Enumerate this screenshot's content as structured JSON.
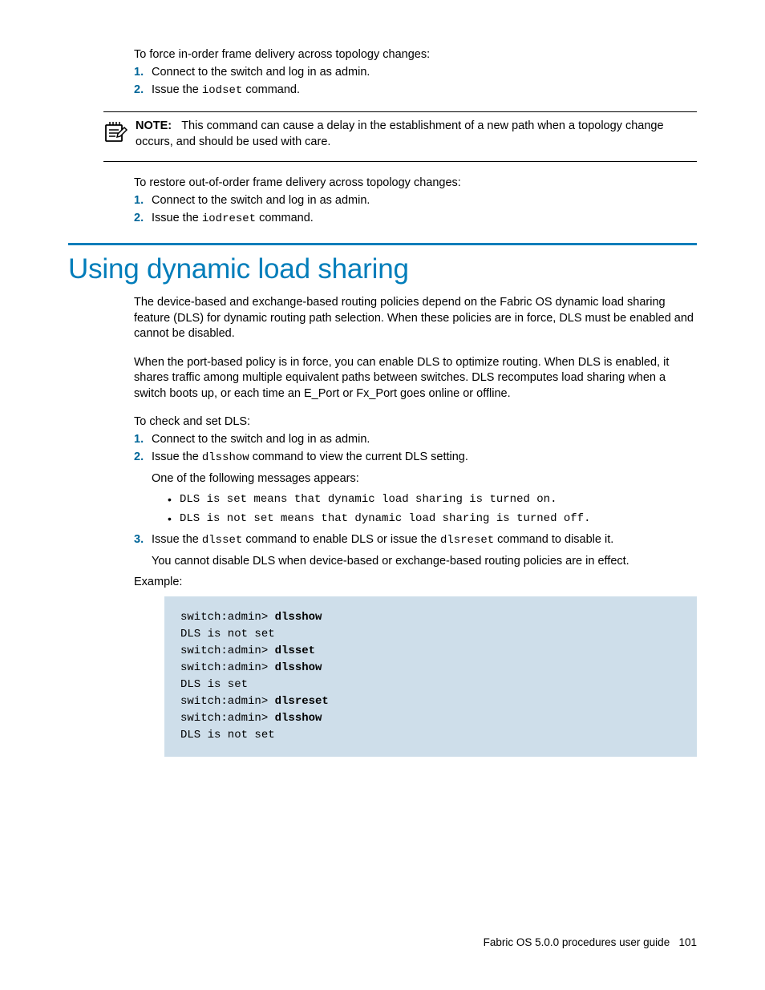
{
  "section1": {
    "intro": "To force in-order frame delivery across topology changes:",
    "item1_num": "1.",
    "item1_text": "Connect to the switch and log in as admin.",
    "item2_num": "2.",
    "item2_prefix": "Issue the ",
    "item2_cmd": "iodset",
    "item2_suffix": " command."
  },
  "note": {
    "label": "NOTE:",
    "text": "This command can cause a delay in the establishment of a new path when a topology change occurs, and should be used with care."
  },
  "section2": {
    "intro": "To restore out-of-order frame delivery across topology changes:",
    "item1_num": "1.",
    "item1_text": "Connect to the switch and log in as admin.",
    "item2_num": "2.",
    "item2_prefix": "Issue the ",
    "item2_cmd": "iodreset",
    "item2_suffix": " command."
  },
  "heading": "Using dynamic load sharing",
  "dls": {
    "para1": "The device-based and exchange-based routing policies depend on the Fabric OS dynamic load sharing feature (DLS) for dynamic routing path selection. When these policies are in force, DLS must be enabled and cannot be disabled.",
    "para2": "When the port-based policy is in force, you can enable DLS to optimize routing. When DLS is enabled, it shares traffic among multiple equivalent paths between switches. DLS recomputes load sharing when a switch boots up, or each time an E_Port or Fx_Port goes online or offline.",
    "intro": "To check and set DLS:",
    "item1_num": "1.",
    "item1_text": "Connect to the switch and log in as admin.",
    "item2_num": "2.",
    "item2_prefix": "Issue the ",
    "item2_cmd": "dlsshow",
    "item2_suffix": " command to view the current DLS setting.",
    "item2_after": "One of the following messages appears:",
    "bullet1": "DLS is set means that dynamic load sharing is turned on.",
    "bullet2": "DLS is not set means that dynamic load sharing is turned off.",
    "item3_num": "3.",
    "item3_prefix": "Issue the ",
    "item3_cmd1": "dlsset",
    "item3_mid": " command to enable DLS or issue the ",
    "item3_cmd2": "dlsreset",
    "item3_suffix": " command to disable it.",
    "item3_after": "You cannot disable DLS when device-based or exchange-based routing policies are in effect.",
    "example_label": "Example:"
  },
  "code": {
    "l1a": "switch:admin> ",
    "l1b": "dlsshow",
    "l2": "DLS is not set",
    "l3a": "switch:admin> ",
    "l3b": "dlsset",
    "l4a": "switch:admin> ",
    "l4b": "dlsshow",
    "l5": "DLS is set",
    "l6a": "switch:admin> ",
    "l6b": "dlsreset",
    "l7a": "switch:admin> ",
    "l7b": "dlsshow",
    "l8": "DLS is not set"
  },
  "footer": {
    "title": "Fabric OS 5.0.0 procedures user guide",
    "page": "101"
  }
}
